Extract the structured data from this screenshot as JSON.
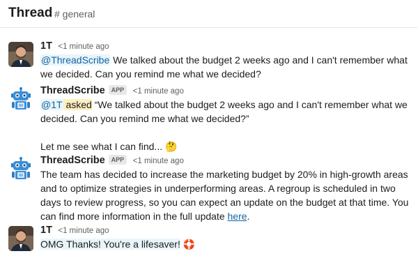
{
  "header": {
    "title": "Thread",
    "channel": "# general"
  },
  "messages": [
    {
      "author": "1T",
      "time": "<1 minute ago",
      "mention": "@ThreadScribe",
      "text": " We talked about the budget 2 weeks ago and I can't remember what we decided. Can you remind me what we decided?"
    },
    {
      "author": "ThreadScribe",
      "badge": "APP",
      "time": "<1 minute ago",
      "mention": "@1T",
      "asked": " asked",
      "quote": " “We talked about the budget 2 weeks ago and I can't remember what we decided. Can you remind me what we decided?”",
      "followup": "Let me see what I can find...",
      "followup_emoji": "🤔"
    },
    {
      "author": "ThreadScribe",
      "badge": "APP",
      "time": "<1 minute ago",
      "text": "The team has decided to increase the marketing budget by 20% in high-growth areas and to optimize strategies in underperforming areas. A regroup is scheduled in two days to review progress, so you can expect an update on the budget at that time. You can find more information in the full update ",
      "link": "here",
      "end": "."
    },
    {
      "author": "1T",
      "time": "<1 minute ago",
      "text": "OMG Thanks! You're a lifesaver!",
      "emoji": "🛟"
    }
  ]
}
